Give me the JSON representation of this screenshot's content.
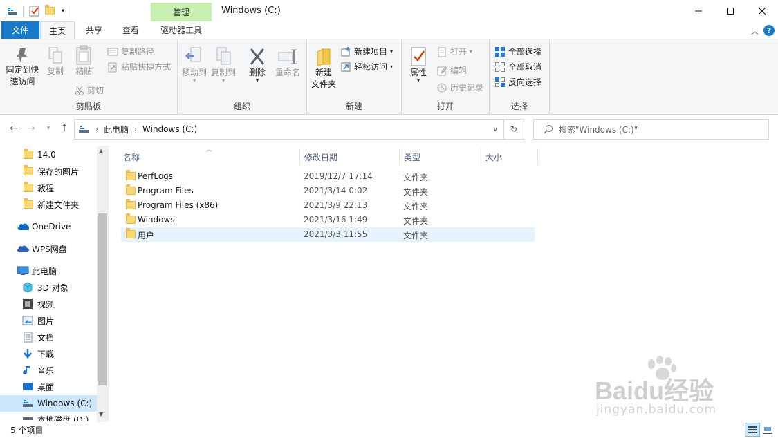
{
  "window": {
    "title": "Windows (C:)",
    "context_tab": "管理",
    "controls": {
      "minimize": "—",
      "maximize": "☐",
      "close": "✕"
    }
  },
  "tabs": [
    "文件",
    "主页",
    "共享",
    "查看",
    "驱动器工具"
  ],
  "ribbon": {
    "clipboard": {
      "label": "剪贴板",
      "pin": "固定到快\n速访问",
      "pin_line1": "固定到快",
      "pin_line2": "速访问",
      "copy": "复制",
      "paste": "粘贴",
      "copy_path": "复制路径",
      "paste_shortcut": "粘贴快捷方式",
      "cut": "剪切"
    },
    "organize": {
      "label": "组织",
      "move_to": "移动到",
      "copy_to": "复制到",
      "delete": "删除",
      "rename": "重命名"
    },
    "new": {
      "label": "新建",
      "new_folder_line1": "新建",
      "new_folder_line2": "文件夹",
      "new_item": "新建项目",
      "easy_access": "轻松访问"
    },
    "open": {
      "label": "打开",
      "properties": "属性",
      "open": "打开",
      "edit": "编辑",
      "history": "历史记录"
    },
    "select": {
      "label": "选择",
      "select_all": "全部选择",
      "select_none": "全部取消",
      "invert": "反向选择"
    }
  },
  "address": {
    "crumbs": [
      "此电脑",
      "Windows (C:)"
    ],
    "search_placeholder": "搜索\"Windows (C:)\""
  },
  "nav": {
    "items": [
      {
        "label": "14.0",
        "icon": "folder-icon"
      },
      {
        "label": "保存的图片",
        "icon": "folder-icon"
      },
      {
        "label": "教程",
        "icon": "folder-icon"
      },
      {
        "label": "新建文件夹",
        "icon": "folder-icon"
      },
      {
        "label": "OneDrive",
        "icon": "onedrive-icon"
      },
      {
        "label": "WPS网盘",
        "icon": "wps-cloud-icon"
      },
      {
        "label": "此电脑",
        "icon": "computer-icon"
      },
      {
        "label": "3D 对象",
        "icon": "3d-objects-icon"
      },
      {
        "label": "视频",
        "icon": "video-icon"
      },
      {
        "label": "图片",
        "icon": "pictures-icon"
      },
      {
        "label": "文档",
        "icon": "documents-icon"
      },
      {
        "label": "下载",
        "icon": "download-icon"
      },
      {
        "label": "音乐",
        "icon": "music-icon"
      },
      {
        "label": "桌面",
        "icon": "desktop-icon"
      },
      {
        "label": "Windows (C:)",
        "icon": "drive-icon"
      },
      {
        "label": "本地磁盘 (D:)",
        "icon": "drive-icon"
      }
    ]
  },
  "files": {
    "columns": [
      "名称",
      "修改日期",
      "类型",
      "大小"
    ],
    "rows": [
      {
        "name": "PerfLogs",
        "date": "2019/12/7 17:14",
        "type": "文件夹"
      },
      {
        "name": "Program Files",
        "date": "2021/3/14 0:02",
        "type": "文件夹"
      },
      {
        "name": "Program Files (x86)",
        "date": "2021/3/9 22:13",
        "type": "文件夹"
      },
      {
        "name": "Windows",
        "date": "2021/3/16 1:49",
        "type": "文件夹"
      },
      {
        "name": "用户",
        "date": "2021/3/3 11:55",
        "type": "文件夹"
      }
    ]
  },
  "status": {
    "count": "5 个项目"
  },
  "watermark": {
    "brand": "Baidu经验",
    "url": "jingyan.baidu.com"
  },
  "colors": {
    "accent": "#1979ca",
    "context_tab": "#c6efb0",
    "selection": "#e5f3ff"
  }
}
